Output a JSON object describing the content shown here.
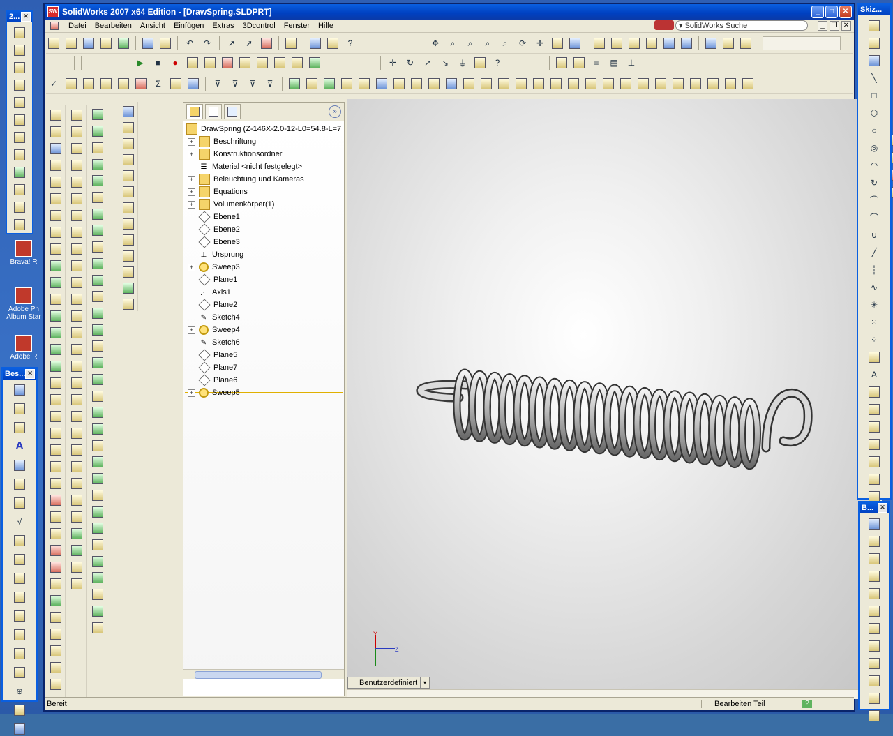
{
  "window": {
    "title": "SolidWorks 2007 x64 Edition - [DrawSpring.SLDPRT]",
    "app_icon": "SW"
  },
  "menu": [
    "Datei",
    "Bearbeiten",
    "Ansicht",
    "Einfügen",
    "Extras",
    "3Dcontrol",
    "Fenster",
    "Hilfe"
  ],
  "search": {
    "label": "SolidWorks Suche"
  },
  "desktop_icons": [
    {
      "label": "Brava! R"
    },
    {
      "label": "Adobe Ph Album Star"
    },
    {
      "label": "Adobe R"
    }
  ],
  "palettes": {
    "left_top": {
      "title": "2..."
    },
    "left_bottom": {
      "title": "Bes..."
    },
    "right_top": {
      "title": "Skiz..."
    },
    "right_bottom": {
      "title": "B..."
    }
  },
  "feature_tree": {
    "root": "DrawSpring  (Z-146X-2.0-12-L0=54.8-L=7",
    "items": [
      {
        "label": "Beschriftung",
        "expand": "+",
        "icon": "annotation-icon"
      },
      {
        "label": "Konstruktionsordner",
        "expand": "+",
        "icon": "design-folder-icon"
      },
      {
        "label": "Material <nicht festgelegt>",
        "expand": "",
        "icon": "material-icon"
      },
      {
        "label": "Beleuchtung und Kameras",
        "expand": "+",
        "icon": "lights-icon"
      },
      {
        "label": "Equations",
        "expand": "+",
        "icon": "equations-icon"
      },
      {
        "label": "Volumenkörper(1)",
        "expand": "+",
        "icon": "solid-bodies-icon"
      },
      {
        "label": "Ebene1",
        "expand": "",
        "icon": "plane-icon"
      },
      {
        "label": "Ebene2",
        "expand": "",
        "icon": "plane-icon"
      },
      {
        "label": "Ebene3",
        "expand": "",
        "icon": "plane-icon"
      },
      {
        "label": "Ursprung",
        "expand": "",
        "icon": "origin-icon"
      },
      {
        "label": "Sweep3",
        "expand": "+",
        "icon": "sweep-icon"
      },
      {
        "label": "Plane1",
        "expand": "",
        "icon": "plane-icon"
      },
      {
        "label": "Axis1",
        "expand": "",
        "icon": "axis-icon"
      },
      {
        "label": "Plane2",
        "expand": "",
        "icon": "plane-icon"
      },
      {
        "label": "Sketch4",
        "expand": "",
        "icon": "sketch-icon"
      },
      {
        "label": "Sweep4",
        "expand": "+",
        "icon": "sweep-icon"
      },
      {
        "label": "Sketch6",
        "expand": "",
        "icon": "sketch-icon"
      },
      {
        "label": "Plane5",
        "expand": "",
        "icon": "plane-icon"
      },
      {
        "label": "Plane7",
        "expand": "",
        "icon": "plane-icon"
      },
      {
        "label": "Plane6",
        "expand": "",
        "icon": "plane-icon"
      },
      {
        "label": "Sweep5",
        "expand": "+",
        "icon": "sweep-icon"
      }
    ]
  },
  "viewport": {
    "view_orientation": "Benutzerdefiniert",
    "triad": {
      "y": "Y",
      "z": "Z"
    }
  },
  "status": {
    "left": "Bereit",
    "right": "Bearbeiten Teil",
    "help": "?"
  }
}
